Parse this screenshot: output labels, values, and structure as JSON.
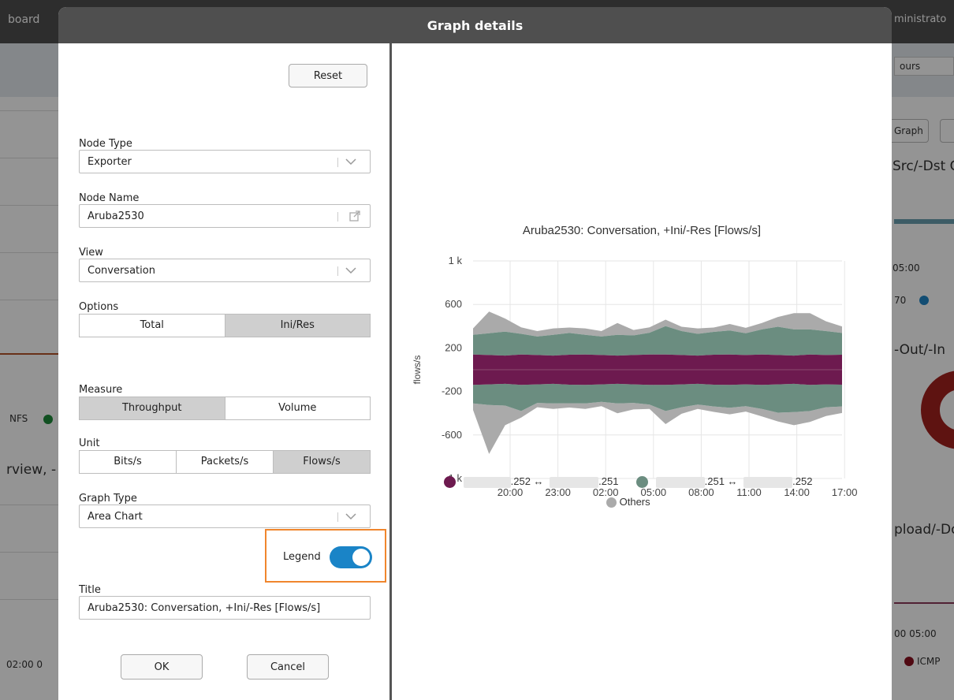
{
  "background": {
    "topbar_left": "board",
    "topbar_right": "ministrato",
    "time_select": "ours",
    "graph_button": "Graph",
    "panel_title_1": "Src/-Dst C",
    "axis_tick_0500": "05:00",
    "legend_partial_1": "70",
    "panel_title_2": "-Out/-In",
    "left_legend_nfs": "NFS",
    "left_panel_title": "rview, -",
    "panel_title_3": "pload/-Do",
    "bottom_ticks_right": "00  05:00",
    "bottom_ticks_left": "02:00  0",
    "legend_icmp": "ICMP"
  },
  "dialog": {
    "title": "Graph details",
    "reset_label": "Reset",
    "node_type": {
      "label": "Node Type",
      "value": "Exporter"
    },
    "node_name": {
      "label": "Node Name",
      "value": "Aruba2530"
    },
    "view": {
      "label": "View",
      "value": "Conversation"
    },
    "options": {
      "label": "Options",
      "items": [
        "Total",
        "Ini/Res"
      ],
      "selected": "Ini/Res"
    },
    "measure": {
      "label": "Measure",
      "items": [
        "Throughput",
        "Volume"
      ],
      "selected": "Throughput"
    },
    "unit": {
      "label": "Unit",
      "items": [
        "Bits/s",
        "Packets/s",
        "Flows/s"
      ],
      "selected": "Flows/s"
    },
    "graph_type": {
      "label": "Graph Type",
      "value": "Area Chart"
    },
    "legend": {
      "label": "Legend",
      "enabled": true
    },
    "title_field": {
      "label": "Title",
      "value": "Aruba2530: Conversation, +Ini/-Res [Flows/s]"
    },
    "ok_label": "OK",
    "cancel_label": "Cancel",
    "highlight_color": "#f0862d",
    "toggle_color": "#1a84c7"
  },
  "chart_data": {
    "type": "area",
    "title": "Aruba2530: Conversation, +Ini/-Res [Flows/s]",
    "ylabel": "flows/s",
    "xlabel": "",
    "y_ticks": [
      "1 k",
      "600",
      "200",
      "-200",
      "-600",
      "-1 k"
    ],
    "y_tick_values": [
      1000,
      600,
      200,
      -200,
      -600,
      -1000
    ],
    "ylim": [
      -1000,
      1000
    ],
    "x_ticks": [
      "20:00",
      "23:00",
      "02:00",
      "05:00",
      "08:00",
      "11:00",
      "14:00",
      "17:00"
    ],
    "grid": true,
    "x": [
      "17:00",
      "18:00",
      "19:00",
      "20:00",
      "21:00",
      "22:00",
      "23:00",
      "00:00",
      "01:00",
      "02:00",
      "03:00",
      "04:00",
      "05:00",
      "06:00",
      "07:00",
      "08:00",
      "09:00",
      "10:00",
      "11:00",
      "12:00",
      "13:00",
      "14:00",
      "15:00",
      "16:00"
    ],
    "series": [
      {
        "color": "#6d1a4f",
        "label_start": ".252 ↔",
        "label_end": ".251",
        "values_pos": [
          140,
          135,
          130,
          140,
          135,
          130,
          138,
          140,
          135,
          130,
          135,
          140,
          140,
          135,
          130,
          138,
          140,
          135,
          140,
          135,
          130,
          140,
          135,
          138
        ],
        "values_neg": [
          -140,
          -135,
          -130,
          -140,
          -135,
          -130,
          -138,
          -140,
          -135,
          -130,
          -135,
          -140,
          -140,
          -135,
          -130,
          -138,
          -140,
          -135,
          -140,
          -135,
          -130,
          -140,
          -135,
          -138
        ]
      },
      {
        "color": "#6b8d80",
        "label_start": ".251 ↔",
        "label_end": ".252",
        "values_pos": [
          180,
          200,
          220,
          190,
          170,
          190,
          200,
          180,
          170,
          190,
          180,
          200,
          260,
          220,
          200,
          210,
          220,
          200,
          230,
          260,
          240,
          230,
          220,
          200
        ],
        "values_neg": [
          -170,
          -190,
          -200,
          -240,
          -170,
          -180,
          -170,
          -170,
          -160,
          -180,
          -170,
          -180,
          -240,
          -210,
          -190,
          -200,
          -210,
          -200,
          -220,
          -260,
          -260,
          -240,
          -210,
          -200
        ]
      },
      {
        "color": "#aaaaaa",
        "name": "Others",
        "values_pos": [
          60,
          200,
          120,
          60,
          50,
          60,
          50,
          60,
          50,
          110,
          50,
          50,
          60,
          40,
          50,
          40,
          60,
          50,
          60,
          90,
          150,
          150,
          90,
          60
        ],
        "values_neg": [
          -60,
          -450,
          -180,
          -60,
          -40,
          -50,
          -40,
          -50,
          -40,
          -90,
          -60,
          -40,
          -120,
          -60,
          -40,
          -50,
          -60,
          -50,
          -70,
          -80,
          -120,
          -100,
          -80,
          -60
        ]
      }
    ],
    "legend_position": "bottom"
  }
}
